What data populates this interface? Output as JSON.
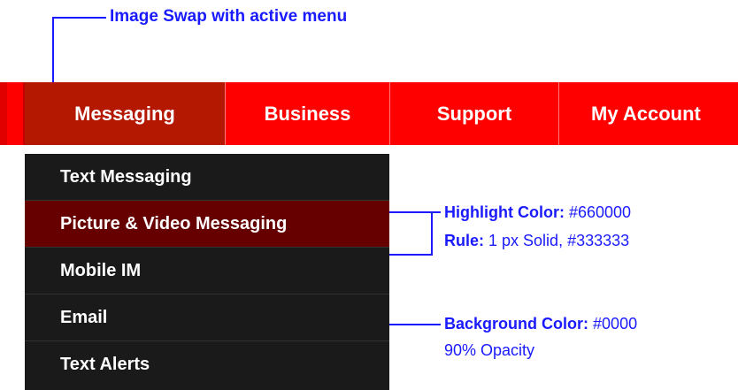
{
  "title_annotation": "Image Swap with active menu",
  "nav": {
    "items": [
      {
        "label": "Messaging",
        "active": true
      },
      {
        "label": "Business",
        "active": false
      },
      {
        "label": "Support",
        "active": false
      },
      {
        "label": "My Account",
        "active": false
      }
    ]
  },
  "submenu": {
    "items": [
      {
        "label": "Text Messaging",
        "highlighted": false
      },
      {
        "label": "Picture & Video Messaging",
        "highlighted": true
      },
      {
        "label": "Mobile IM",
        "highlighted": false
      },
      {
        "label": "Email",
        "highlighted": false
      },
      {
        "label": "Text Alerts",
        "highlighted": false
      }
    ]
  },
  "annotations": {
    "highlight": {
      "label": "Highlight Color:",
      "value": "#660000"
    },
    "rule": {
      "label": "Rule:",
      "value": "1 px Solid, #333333"
    },
    "background": {
      "label": "Background Color:",
      "value": "#0000",
      "note": "90% Opacity"
    }
  },
  "colors": {
    "nav_bg": "#ff0000",
    "nav_active": "#b41800",
    "submenu_bg": "#1a1a1a",
    "highlight": "#660000",
    "rule": "#333333",
    "annotation": "#1a1aff"
  }
}
